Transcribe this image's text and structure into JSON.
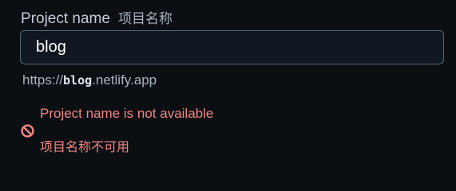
{
  "field": {
    "label": "Project name",
    "label_zh": "项目名称",
    "value": "blog"
  },
  "url_preview": {
    "prefix": "https://",
    "name": "blog",
    "suffix": ".netlify.app"
  },
  "error": {
    "icon": "prohibited-icon",
    "message": "Project name is not available",
    "message_zh": "项目名称不可用",
    "color": "#f08580"
  },
  "colors": {
    "background": "#0b0e13",
    "input_background": "#111720",
    "input_border": "#5b6674"
  }
}
